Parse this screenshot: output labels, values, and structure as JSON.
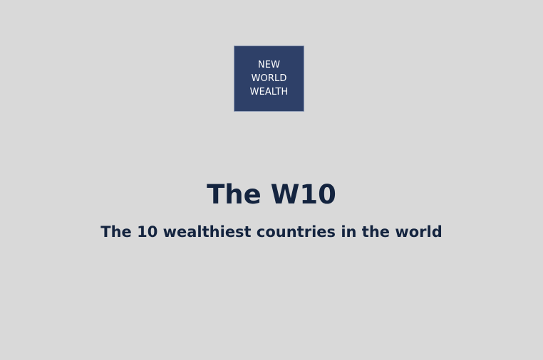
{
  "logo": {
    "lines": [
      "NEW",
      "WORLD",
      "WEALTH"
    ],
    "background_color": "#2e4068",
    "text_color": "#ffffff"
  },
  "title": "The W10",
  "subtitle": "The 10 wealthiest countries in the world",
  "colors": {
    "page_background": "#d9d9d9",
    "heading_text": "#14243f"
  }
}
